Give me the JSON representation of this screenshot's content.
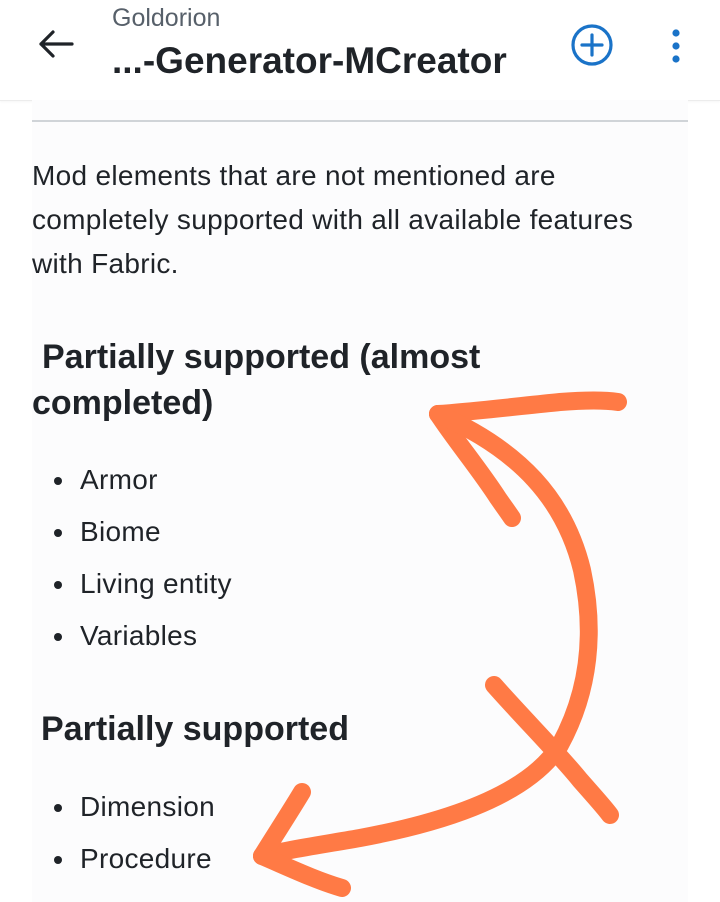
{
  "header": {
    "owner": "Goldorion",
    "title": "...-Generator-MCreator",
    "back_icon": "arrow-left-icon",
    "add_icon": "plus-circle-icon",
    "more_icon": "more-vertical-icon",
    "accent_color": "#1a73c8"
  },
  "content": {
    "intro": "Mod elements that are not mentioned are completely supported with all available features with Fabric.",
    "section_almost": {
      "heading_line1": "Partially supported (almost",
      "heading_line2": "completed)",
      "items": [
        "Armor",
        "Biome",
        "Living entity",
        "Variables"
      ]
    },
    "section_partial": {
      "heading": "Partially supported",
      "items": [
        "Dimension",
        "Procedure"
      ]
    }
  },
  "annotation": {
    "description": "hand-drawn arrows",
    "color": "#ff7a45"
  }
}
